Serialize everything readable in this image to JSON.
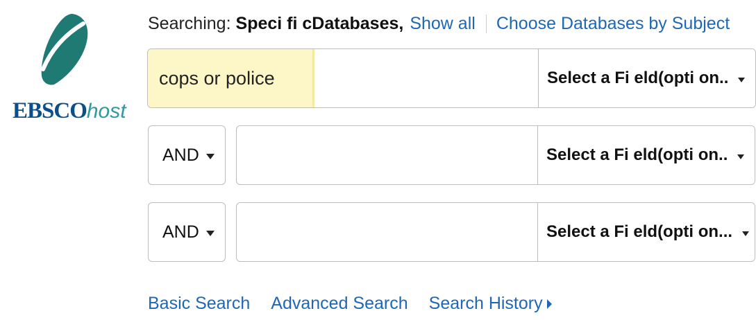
{
  "logo": {
    "brand_bold": "EBSCO",
    "brand_italic": "host",
    "mark_icon": "ebsco-leaf-icon",
    "colors": {
      "mark": "#1e7a73",
      "ebsco": "#0b4f8a",
      "host": "#2c9aa0"
    }
  },
  "searching": {
    "prefix": "Searching:",
    "value": "Speci fi cDatabases,",
    "show_all": "Show all",
    "choose_by_subject": "Choose Databases by Subject"
  },
  "rows": [
    {
      "input_value": "cops or police",
      "field": "Select a Fi eld(opti on..",
      "caret_icon": "caret-down-icon"
    },
    {
      "operator": "AND",
      "input_value": "",
      "field": "Select a Fi eld(opti on..",
      "caret_icon": "caret-down-icon"
    },
    {
      "operator": "AND",
      "input_value": "",
      "field": "Select a Fi eld(opti on...",
      "caret_icon": "caret-down-icon"
    }
  ],
  "bottom_links": {
    "basic": "Basic Search",
    "advanced": "Advanced Search",
    "history": "Search History",
    "history_icon": "caret-right-icon"
  },
  "colors": {
    "link": "#1f67b4",
    "highlight": "#fdf6c6",
    "border": "#bdbdbd"
  }
}
